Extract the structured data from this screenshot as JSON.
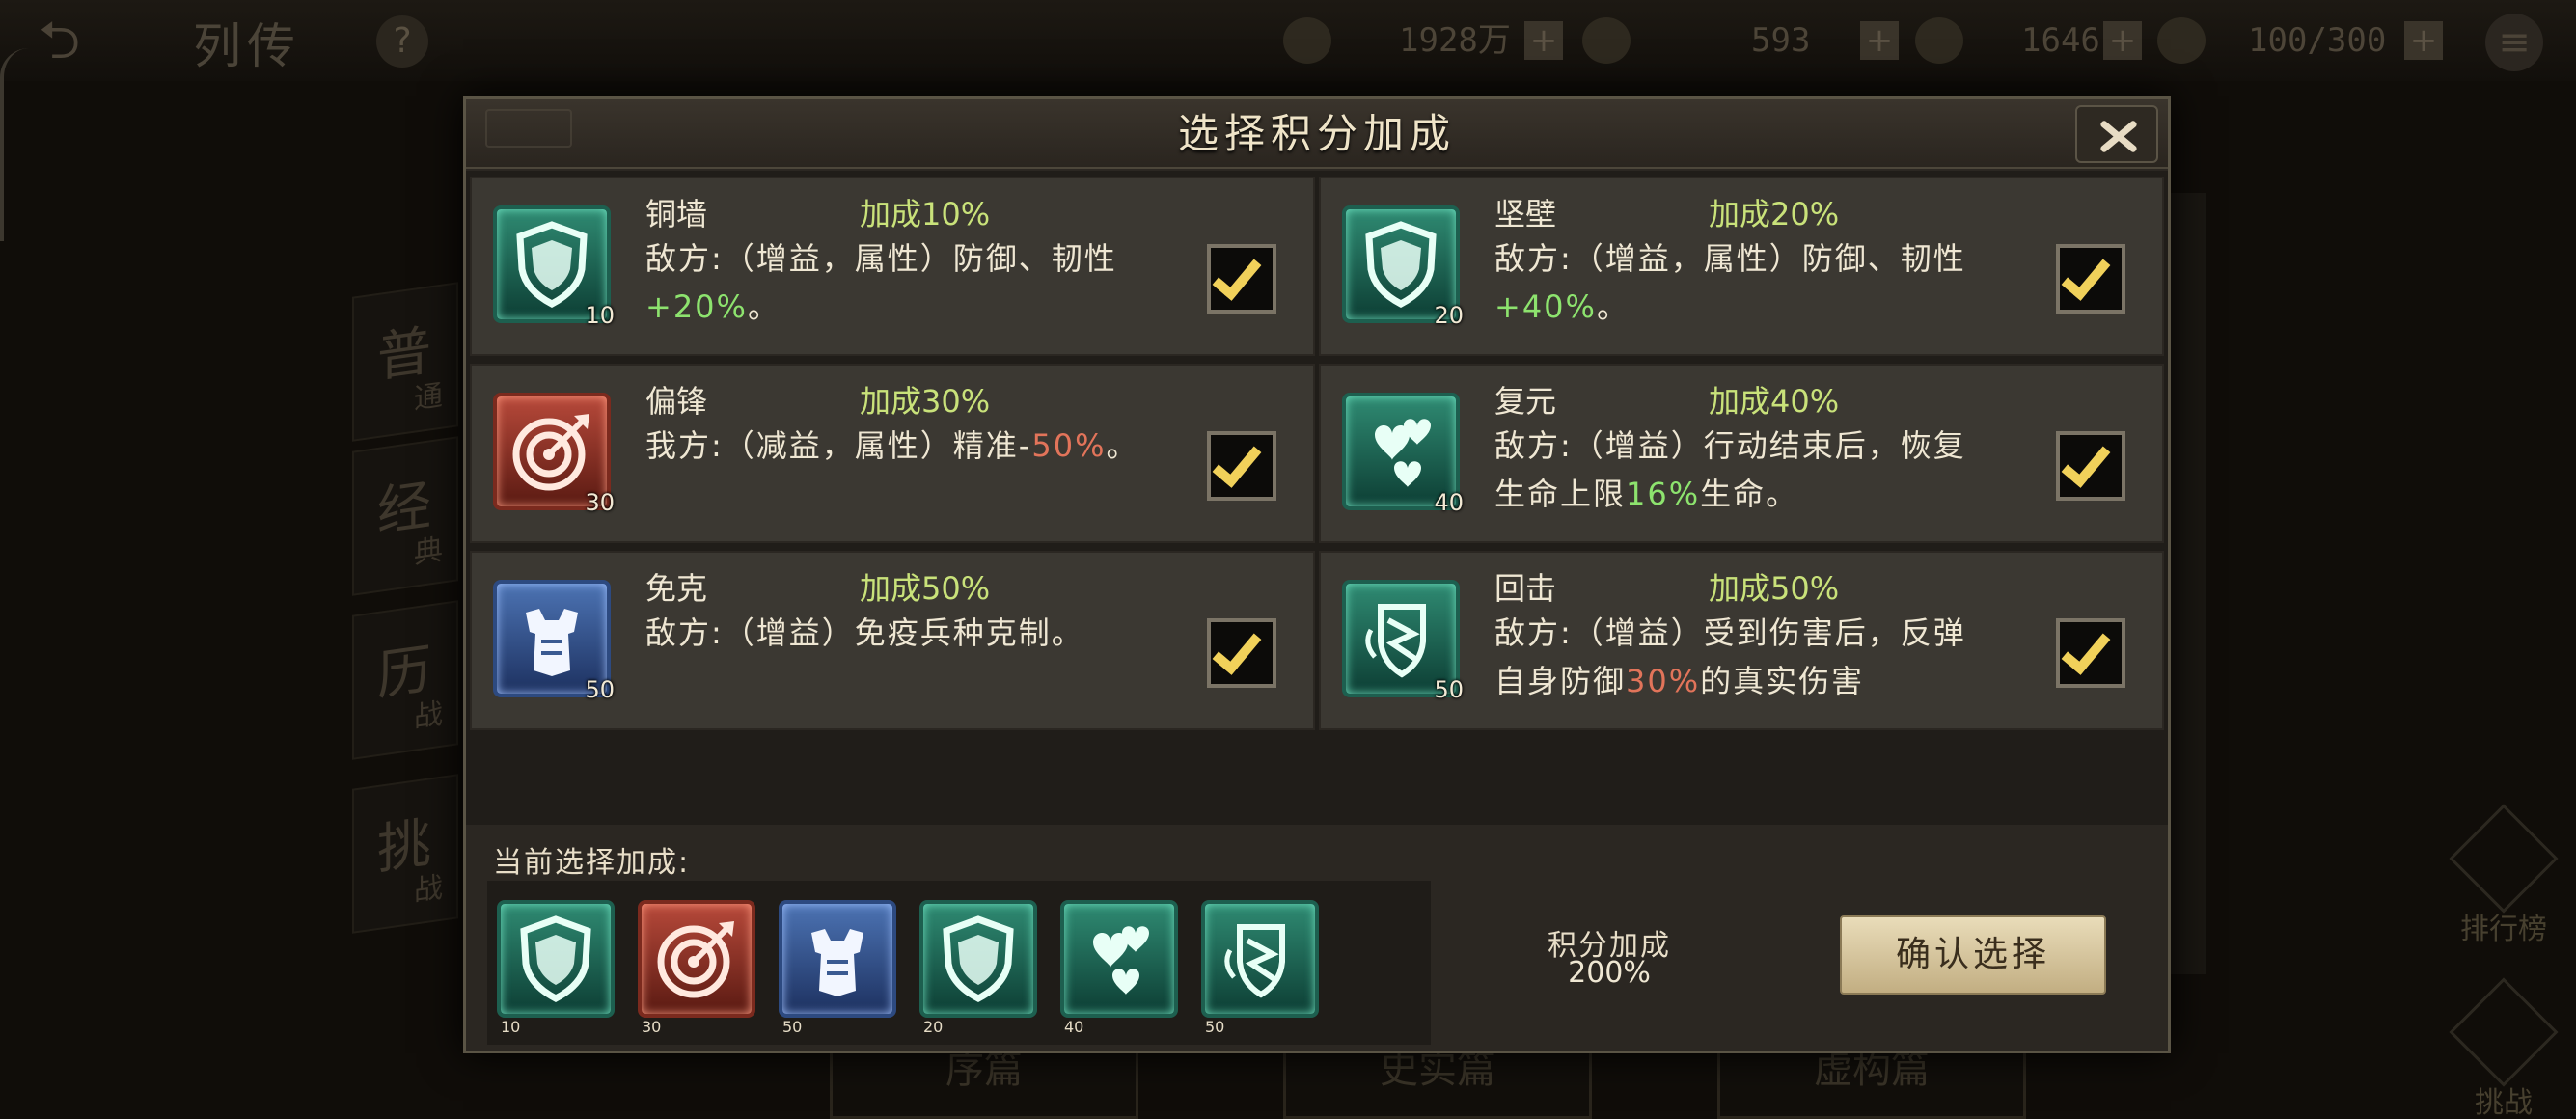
{
  "background": {
    "title": "列传",
    "resources": {
      "copper": "1928万",
      "jade": "593",
      "gems": "1646",
      "stamina": "100/300"
    },
    "side_tabs": [
      {
        "big": "普",
        "small": "通"
      },
      {
        "big": "经",
        "small": "典"
      },
      {
        "big": "历",
        "small": "战"
      },
      {
        "big": "挑",
        "small": "战"
      }
    ],
    "right_buttons": [
      "排行榜",
      "挑战"
    ],
    "bottom_tabs": [
      "序篇",
      "史实篇",
      "虚构篇"
    ]
  },
  "modal": {
    "title": "选择积分加成",
    "cards": [
      {
        "name": "铜墙",
        "bonus": "加成10%",
        "desc_parts": [
          "敌方:（增益，属性）防御、韧性",
          "+20%",
          "。"
        ],
        "desc_hl": "green",
        "badge": "10",
        "icon": "shield-icon",
        "color": "green",
        "checked": true
      },
      {
        "name": "坚壁",
        "bonus": "加成20%",
        "desc_parts": [
          "敌方:（增益，属性）防御、韧性",
          "+40%",
          "。"
        ],
        "desc_hl": "green",
        "badge": "20",
        "icon": "shield-icon",
        "color": "green",
        "checked": true
      },
      {
        "name": "偏锋",
        "bonus": "加成30%",
        "desc_parts": [
          "我方:（减益，属性）精准-",
          "50%",
          "。"
        ],
        "desc_hl": "red",
        "badge": "30",
        "icon": "target-icon",
        "color": "red",
        "checked": true
      },
      {
        "name": "复元",
        "bonus": "加成40%",
        "desc_parts": [
          "敌方:（增益）行动结束后，恢复生命上限",
          "16%",
          "生命。"
        ],
        "desc_hl": "green",
        "badge": "40",
        "icon": "hearts-icon",
        "color": "green",
        "checked": true
      },
      {
        "name": "免克",
        "bonus": "加成50%",
        "desc_parts": [
          "敌方:（增益）免疫兵种克制。",
          "",
          ""
        ],
        "desc_hl": "green",
        "badge": "50",
        "icon": "armor-icon",
        "color": "blue",
        "checked": true
      },
      {
        "name": "回击",
        "bonus": "加成50%",
        "desc_parts": [
          "敌方:（增益）受到伤害后，反弹自身防御",
          "30%",
          "的真实伤害"
        ],
        "desc_hl": "red",
        "badge": "50",
        "icon": "counter-icon",
        "color": "green",
        "checked": true
      }
    ],
    "selected_label": "当前选择加成:",
    "selected": [
      {
        "icon": "shield-icon",
        "color": "green",
        "badge": "10"
      },
      {
        "icon": "target-icon",
        "color": "red",
        "badge": "30"
      },
      {
        "icon": "armor-icon",
        "color": "blue",
        "badge": "50"
      },
      {
        "icon": "shield-icon",
        "color": "green",
        "badge": "20"
      },
      {
        "icon": "hearts-icon",
        "color": "green",
        "badge": "40"
      },
      {
        "icon": "counter-icon",
        "color": "green",
        "badge": "50"
      }
    ],
    "score_label": "积分加成",
    "score_value": "200%",
    "confirm_label": "确认选择"
  }
}
